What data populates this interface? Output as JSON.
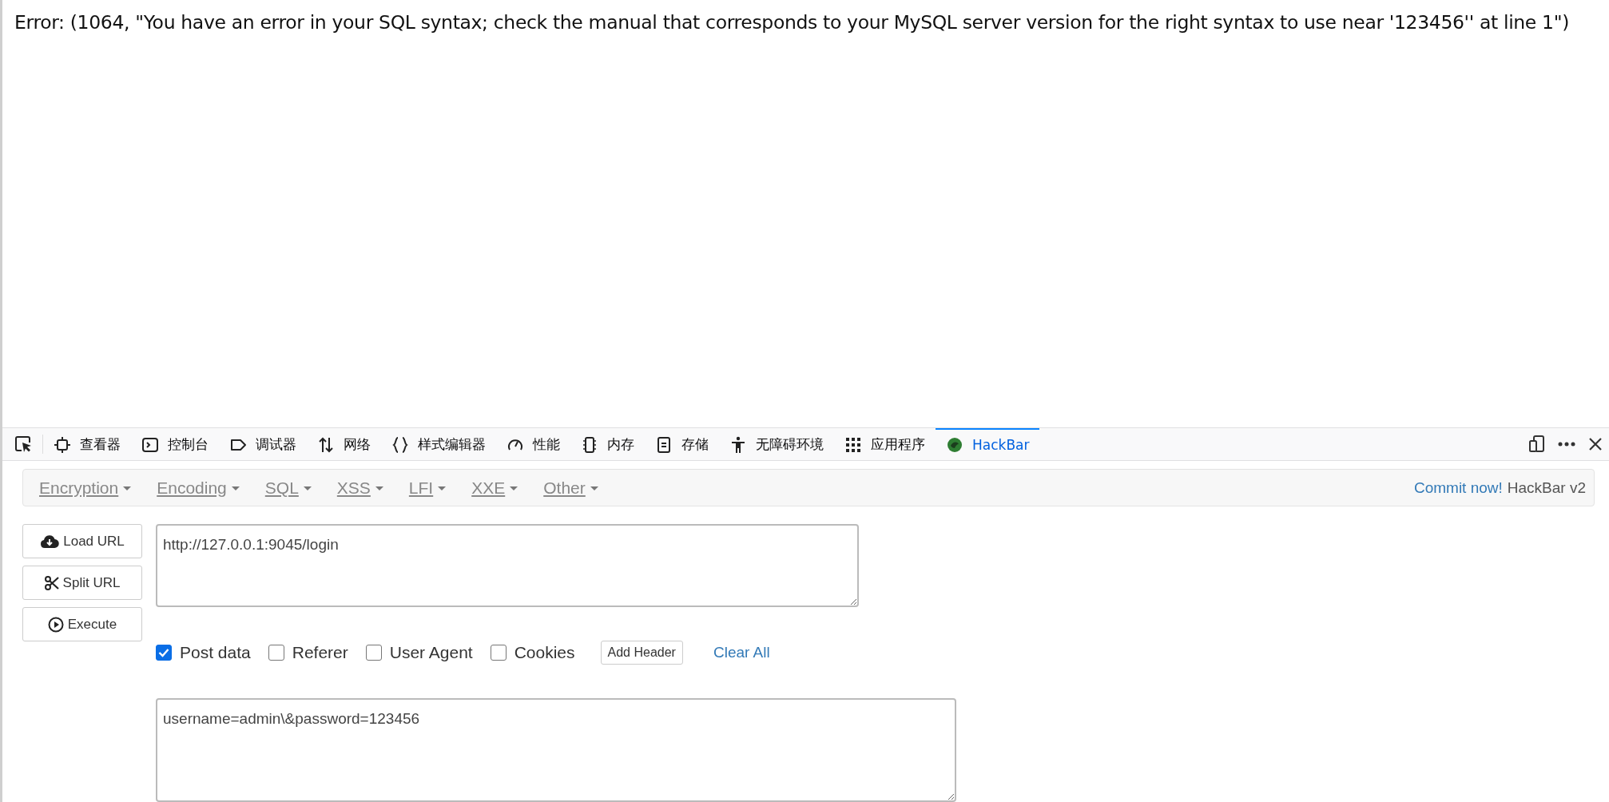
{
  "error_message": "Error: (1064, \"You have an error in your SQL syntax; check the manual that corresponds to your MySQL server version for the right syntax to use near '123456'' at line 1\")",
  "devtools": {
    "tabs": [
      {
        "label": "查看器",
        "selected": false
      },
      {
        "label": "控制台",
        "selected": false
      },
      {
        "label": "调试器",
        "selected": false
      },
      {
        "label": "网络",
        "selected": false
      },
      {
        "label": "样式编辑器",
        "selected": false
      },
      {
        "label": "性能",
        "selected": false
      },
      {
        "label": "内存",
        "selected": false
      },
      {
        "label": "存储",
        "selected": false
      },
      {
        "label": "无障碍环境",
        "selected": false
      },
      {
        "label": "应用程序",
        "selected": false
      },
      {
        "label": "HackBar",
        "selected": true
      }
    ]
  },
  "hackbar": {
    "menus": [
      "Encryption",
      "Encoding",
      "SQL",
      "XSS",
      "LFI",
      "XXE",
      "Other"
    ],
    "commit_link": "Commit now!",
    "version": "HackBar v2",
    "actions": [
      {
        "label": "Load URL",
        "kind": "load"
      },
      {
        "label": "Split URL",
        "kind": "split"
      },
      {
        "label": "Execute",
        "kind": "execute"
      }
    ],
    "url": "http://127.0.0.1:9045/login",
    "options": [
      {
        "label": "Post data",
        "checked": true
      },
      {
        "label": "Referer",
        "checked": false
      },
      {
        "label": "User Agent",
        "checked": false
      },
      {
        "label": "Cookies",
        "checked": false
      }
    ],
    "add_header": "Add Header",
    "clear_all": "Clear All",
    "post_body": "username=admin\\&password=123456"
  }
}
